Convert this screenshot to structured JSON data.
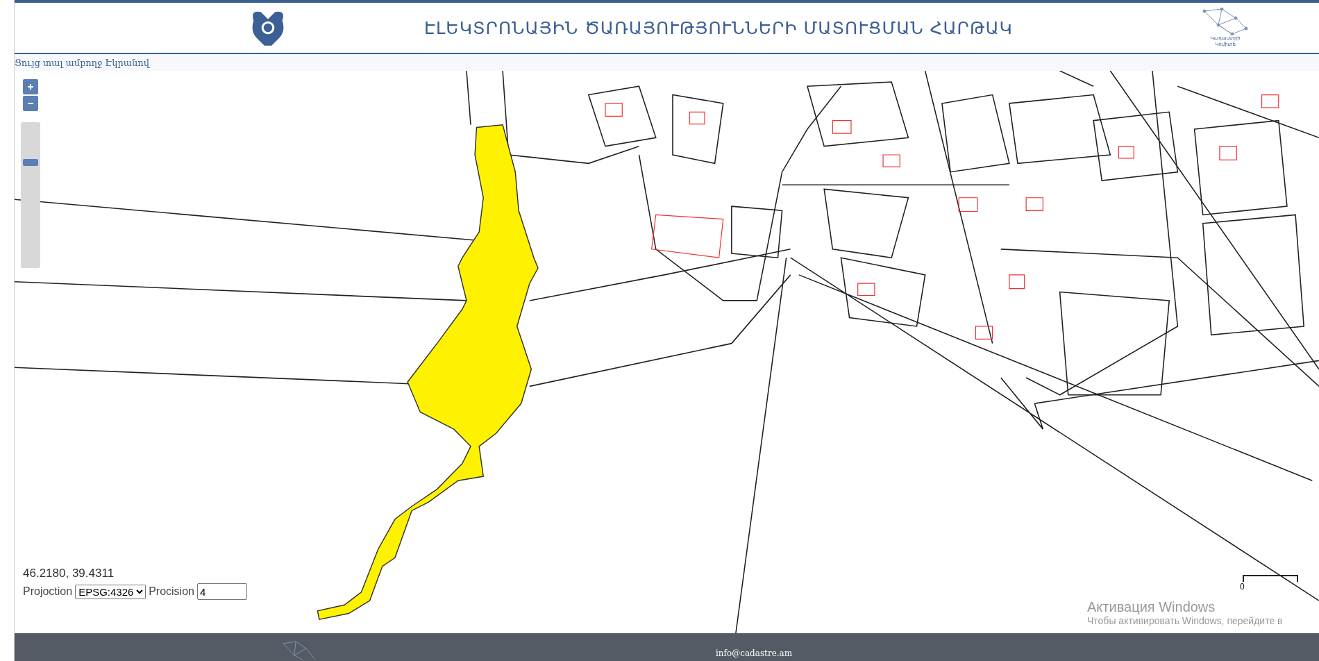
{
  "header": {
    "title": "ԷԼԵԿՏՐՈՆԱՅԻՆ ԾԱՌԱՅՈՒԹՅՈՒՆՆԵՐԻ ՄԱՏՈՒՑՄԱՆ ՀԱՐԹԱԿ",
    "logo_text": [
      "Կադաստրի",
      "Կոմիտե"
    ]
  },
  "fullscreen_link": "Ցույց տալ ամբողջ Էկրանով",
  "zoom": {
    "level": 0.75
  },
  "coordinates": "46.2180, 39.4311",
  "projection": {
    "label": "Projoction",
    "value": "EPSG:4326"
  },
  "precision": {
    "label": "Procision",
    "value": "4"
  },
  "scale_bar": {
    "label": "0"
  },
  "os_notice": {
    "title": "Активация Windows",
    "text": "Чтобы активировать Windows, перейдите в"
  },
  "footer": {
    "email": "info@cadastre.am"
  }
}
